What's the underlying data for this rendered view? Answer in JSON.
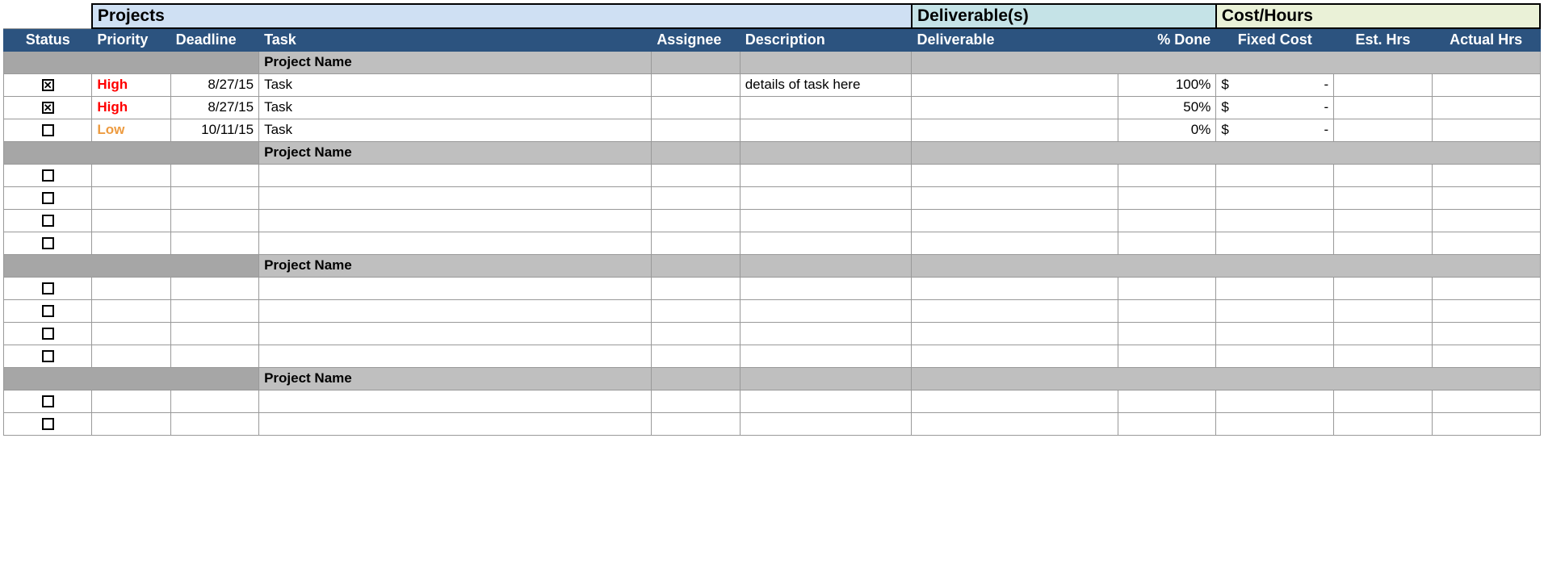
{
  "sections": {
    "projects": "Projects",
    "deliverables": "Deliverable(s)",
    "cost": "Cost/Hours"
  },
  "columns": {
    "status": "Status",
    "priority": "Priority",
    "deadline": "Deadline",
    "task": "Task",
    "assignee": "Assignee",
    "description": "Description",
    "deliverable": "Deliverable",
    "pct_done": "% Done",
    "fixed_cost": "Fixed Cost",
    "est_hrs": "Est. Hrs",
    "actual_hrs": "Actual Hrs"
  },
  "group_label": "Project Name",
  "currency_symbol": "$",
  "currency_dash": "-",
  "groups": [
    {
      "name": "Project Name",
      "rows": [
        {
          "checked": true,
          "priority": "High",
          "priority_class": "priority-high",
          "deadline": "8/27/15",
          "task": "Task",
          "assignee": "",
          "description": "details of task here",
          "deliverable": "",
          "pct_done": "100%",
          "has_cost": true,
          "est_hrs": "",
          "actual_hrs": ""
        },
        {
          "checked": true,
          "priority": "High",
          "priority_class": "priority-high",
          "deadline": "8/27/15",
          "task": "Task",
          "assignee": "",
          "description": "",
          "deliverable": "",
          "pct_done": "50%",
          "has_cost": true,
          "est_hrs": "",
          "actual_hrs": ""
        },
        {
          "checked": false,
          "priority": "Low",
          "priority_class": "priority-low",
          "deadline": "10/11/15",
          "task": "Task",
          "assignee": "",
          "description": "",
          "deliverable": "",
          "pct_done": "0%",
          "has_cost": true,
          "est_hrs": "",
          "actual_hrs": ""
        }
      ]
    },
    {
      "name": "Project Name",
      "rows": [
        {
          "checked": false,
          "priority": "",
          "priority_class": "",
          "deadline": "",
          "task": "",
          "assignee": "",
          "description": "",
          "deliverable": "",
          "pct_done": "",
          "has_cost": false,
          "est_hrs": "",
          "actual_hrs": ""
        },
        {
          "checked": false,
          "priority": "",
          "priority_class": "",
          "deadline": "",
          "task": "",
          "assignee": "",
          "description": "",
          "deliverable": "",
          "pct_done": "",
          "has_cost": false,
          "est_hrs": "",
          "actual_hrs": ""
        },
        {
          "checked": false,
          "priority": "",
          "priority_class": "",
          "deadline": "",
          "task": "",
          "assignee": "",
          "description": "",
          "deliverable": "",
          "pct_done": "",
          "has_cost": false,
          "est_hrs": "",
          "actual_hrs": ""
        },
        {
          "checked": false,
          "priority": "",
          "priority_class": "",
          "deadline": "",
          "task": "",
          "assignee": "",
          "description": "",
          "deliverable": "",
          "pct_done": "",
          "has_cost": false,
          "est_hrs": "",
          "actual_hrs": ""
        }
      ]
    },
    {
      "name": "Project Name",
      "rows": [
        {
          "checked": false,
          "priority": "",
          "priority_class": "",
          "deadline": "",
          "task": "",
          "assignee": "",
          "description": "",
          "deliverable": "",
          "pct_done": "",
          "has_cost": false,
          "est_hrs": "",
          "actual_hrs": ""
        },
        {
          "checked": false,
          "priority": "",
          "priority_class": "",
          "deadline": "",
          "task": "",
          "assignee": "",
          "description": "",
          "deliverable": "",
          "pct_done": "",
          "has_cost": false,
          "est_hrs": "",
          "actual_hrs": ""
        },
        {
          "checked": false,
          "priority": "",
          "priority_class": "",
          "deadline": "",
          "task": "",
          "assignee": "",
          "description": "",
          "deliverable": "",
          "pct_done": "",
          "has_cost": false,
          "est_hrs": "",
          "actual_hrs": ""
        },
        {
          "checked": false,
          "priority": "",
          "priority_class": "",
          "deadline": "",
          "task": "",
          "assignee": "",
          "description": "",
          "deliverable": "",
          "pct_done": "",
          "has_cost": false,
          "est_hrs": "",
          "actual_hrs": ""
        }
      ]
    },
    {
      "name": "Project Name",
      "rows": [
        {
          "checked": false,
          "priority": "",
          "priority_class": "",
          "deadline": "",
          "task": "",
          "assignee": "",
          "description": "",
          "deliverable": "",
          "pct_done": "",
          "has_cost": false,
          "est_hrs": "",
          "actual_hrs": ""
        },
        {
          "checked": false,
          "priority": "",
          "priority_class": "",
          "deadline": "",
          "task": "",
          "assignee": "",
          "description": "",
          "deliverable": "",
          "pct_done": "",
          "has_cost": false,
          "est_hrs": "",
          "actual_hrs": ""
        }
      ]
    }
  ]
}
